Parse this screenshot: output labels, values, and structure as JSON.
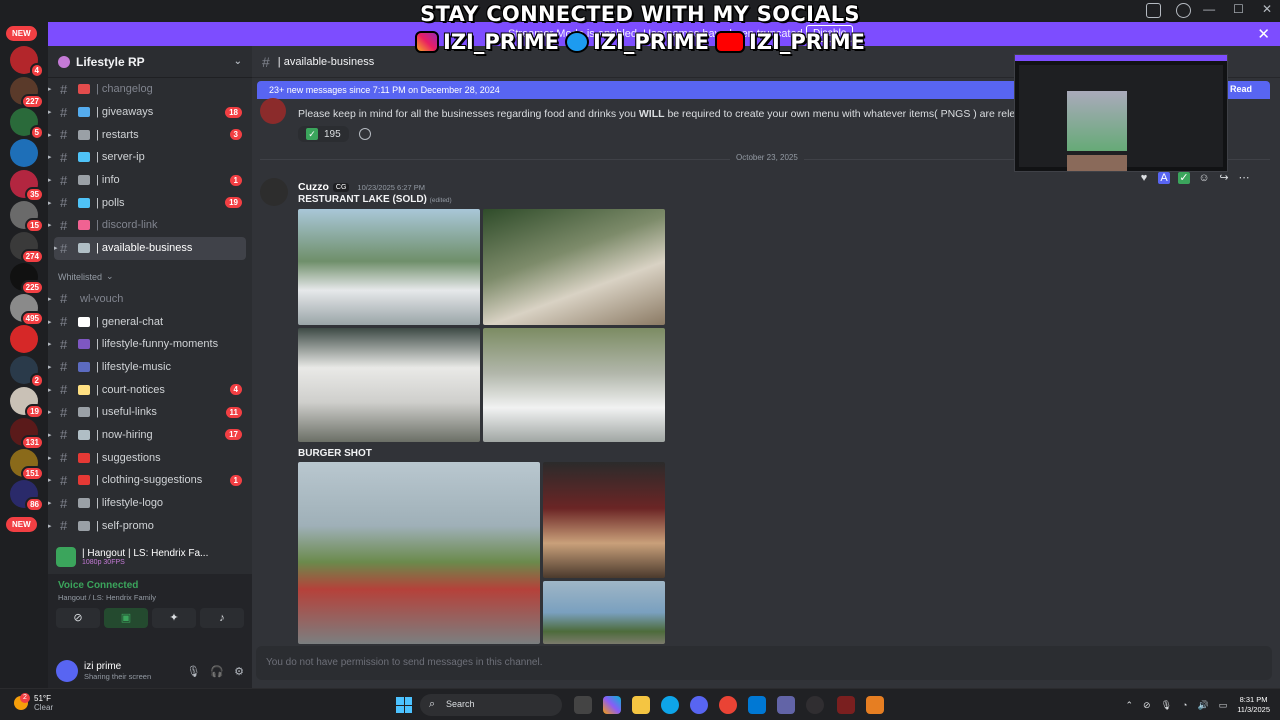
{
  "overlay": {
    "headline": "STAY CONNECTED WITH MY SOCIALS",
    "socials": [
      {
        "platform": "instagram-icon",
        "handle": "IZI_PRIME"
      },
      {
        "platform": "twitter-icon",
        "handle": "IZI_PRIME"
      },
      {
        "platform": "youtube-icon",
        "handle": "IZI_PRIME"
      }
    ]
  },
  "banner": {
    "text": "Streamer Mode is enabled. Usernames have been truncated.",
    "disable_label": "Disable",
    "close_icon": "✕"
  },
  "rail": {
    "new_top": "NEW",
    "new_bottom": "NEW",
    "servers": [
      {
        "badge": "4",
        "color": "#b3262b"
      },
      {
        "badge": "227",
        "color": "#5a3a2a"
      },
      {
        "badge": "5",
        "color": "#2a6a3a"
      },
      {
        "badge": "",
        "color": "#1e6fb8"
      },
      {
        "badge": "35",
        "color": "#b32640"
      },
      {
        "badge": "15",
        "color": "#6a6a6a"
      },
      {
        "badge": "274",
        "color": "#3a3a3a"
      },
      {
        "badge": "225",
        "color": "#111111"
      },
      {
        "badge": "495",
        "color": "#8a8a8a"
      },
      {
        "badge": "",
        "color": "#d62828"
      },
      {
        "badge": "2",
        "color": "#2a3a4a"
      },
      {
        "badge": "19",
        "color": "#c9c1b6"
      },
      {
        "badge": "131",
        "color": "#5a1a1a"
      },
      {
        "badge": "151",
        "color": "#8a6a1a"
      },
      {
        "badge": "86",
        "color": "#2a2a6a"
      }
    ]
  },
  "sidebar": {
    "server_name": "Lifestyle RP",
    "channels": [
      {
        "emoji_color": "#e34c4c",
        "label": "| changelog",
        "badge": "",
        "muted": true
      },
      {
        "emoji_color": "#55acee",
        "label": "| giveaways",
        "badge": "18",
        "muted": false
      },
      {
        "emoji_color": "#9aa0a6",
        "label": "| restarts",
        "badge": "3",
        "muted": false
      },
      {
        "emoji_color": "#4fc3f7",
        "label": "| server-ip",
        "badge": "",
        "muted": false
      },
      {
        "emoji_color": "#9aa0a6",
        "label": "| info",
        "badge": "1",
        "muted": false
      },
      {
        "emoji_color": "#4fc3f7",
        "label": "| polls",
        "badge": "19",
        "muted": false
      },
      {
        "emoji_color": "#f06292",
        "label": "| discord-link",
        "badge": "",
        "muted": true
      },
      {
        "emoji_color": "#b0bec5",
        "label": "| available-business",
        "badge": "",
        "muted": false,
        "active": true
      }
    ],
    "category": "Whitelisted",
    "channels2": [
      {
        "emoji_color": "",
        "label": "wl-vouch",
        "badge": "",
        "muted": true
      },
      {
        "emoji_color": "#ffffff",
        "label": "| general-chat",
        "badge": "",
        "muted": false
      },
      {
        "emoji_color": "#7e57c2",
        "label": "| lifestyle-funny-moments",
        "badge": "",
        "muted": false
      },
      {
        "emoji_color": "#5c6bc0",
        "label": "| lifestyle-music",
        "badge": "",
        "muted": false
      },
      {
        "emoji_color": "#ffe082",
        "label": "| court-notices",
        "badge": "4",
        "muted": false
      },
      {
        "emoji_color": "#9aa0a6",
        "label": "| useful-links",
        "badge": "11",
        "muted": false
      },
      {
        "emoji_color": "#b0bec5",
        "label": "| now-hiring",
        "badge": "17",
        "muted": false
      },
      {
        "emoji_color": "#e53935",
        "label": "| suggestions",
        "badge": "",
        "muted": false
      },
      {
        "emoji_color": "#e53935",
        "label": "| clothing-suggestions",
        "badge": "1",
        "muted": false
      },
      {
        "emoji_color": "#9aa0a6",
        "label": "| lifestyle-logo",
        "badge": "",
        "muted": false
      },
      {
        "emoji_color": "#9aa0a6",
        "label": "| self-promo",
        "badge": "",
        "muted": false
      }
    ]
  },
  "voice": {
    "stream_title": "| Hangout | LS: Hendrix Fa...",
    "stream_quality": "1080p 30FPS",
    "status": "Voice Connected",
    "location": "Hangout / LS: Hendrix Family"
  },
  "user": {
    "name": "izi prime",
    "status": "Sharing their screen"
  },
  "main": {
    "channel_name": "| available-business",
    "new_messages": "23+ new messages since 7:11 PM on December 28, 2024",
    "mark_read": "Mark As Read",
    "msg1_text_before": "Please keep in mind for all the businesses regarding food and drinks you ",
    "msg1_bold": "WILL",
    "msg1_text_after": " be required to create your own menu with whatever items( PNGS ) are relevant to",
    "reaction_count": "195",
    "date_divider": "October 23, 2025",
    "author": "Cuzzo",
    "author_tag": "CG",
    "timestamp": "10/23/2025 6:27 PM",
    "section1": "RESTURANT LAKE (SOLD)",
    "edited": "(edited)",
    "section2": "BURGER SHOT",
    "composer": "You do not have permission to send messages in this channel."
  },
  "taskbar": {
    "weather_temp": "51°F",
    "weather_desc": "Clear",
    "weather_badge": "2",
    "search_label": "Search",
    "time": "8:31 PM",
    "date": "11/3/2025"
  }
}
